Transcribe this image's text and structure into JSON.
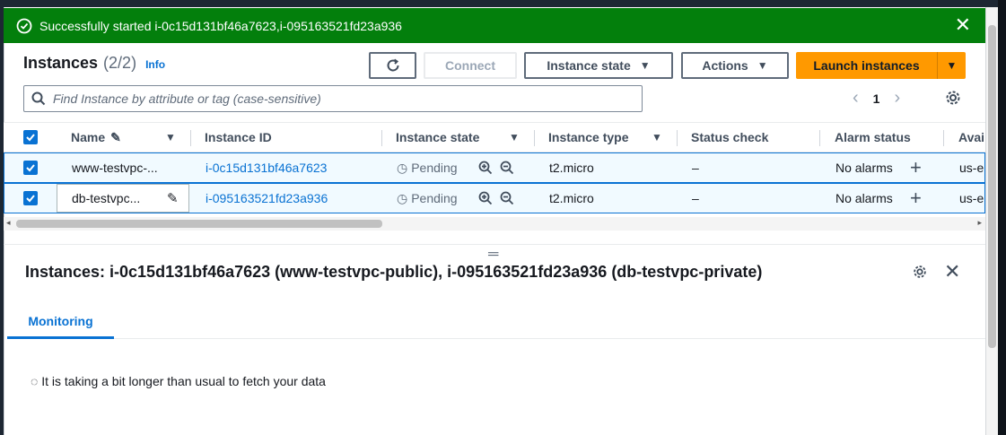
{
  "flash": {
    "message": "Successfully started i-0c15d131bf46a7623,i-095163521fd23a936",
    "close": "✕"
  },
  "header": {
    "title": "Instances",
    "count": "(2/2)",
    "info": "Info"
  },
  "toolbar": {
    "connect": "Connect",
    "instance_state": "Instance state",
    "actions": "Actions",
    "launch": "Launch instances"
  },
  "search": {
    "placeholder": "Find Instance by attribute or tag (case-sensitive)"
  },
  "pagination": {
    "page": "1"
  },
  "table": {
    "columns": {
      "name": "Name",
      "instance_id": "Instance ID",
      "instance_state": "Instance state",
      "instance_type": "Instance type",
      "status_check": "Status check",
      "alarm_status": "Alarm status",
      "availability": "Avai"
    },
    "rows": [
      {
        "name": "www-testvpc-...",
        "instance_id": "i-0c15d131bf46a7623",
        "state": "Pending",
        "type": "t2.micro",
        "status_check": "–",
        "alarm": "No alarms",
        "az": "us-e"
      },
      {
        "name": "db-testvpc...",
        "instance_id": "i-095163521fd23a936",
        "state": "Pending",
        "type": "t2.micro",
        "status_check": "–",
        "alarm": "No alarms",
        "az": "us-e"
      }
    ]
  },
  "details": {
    "title": "Instances: i-0c15d131bf46a7623 (www-testvpc-public), i-095163521fd23a936 (db-testvpc-private)",
    "tab": "Monitoring",
    "status": "It is taking a bit longer than usual to fetch your data"
  },
  "colors": {
    "flash_success": "#037f0c",
    "accent": "#0972d3",
    "launch_button": "#ff9900"
  }
}
